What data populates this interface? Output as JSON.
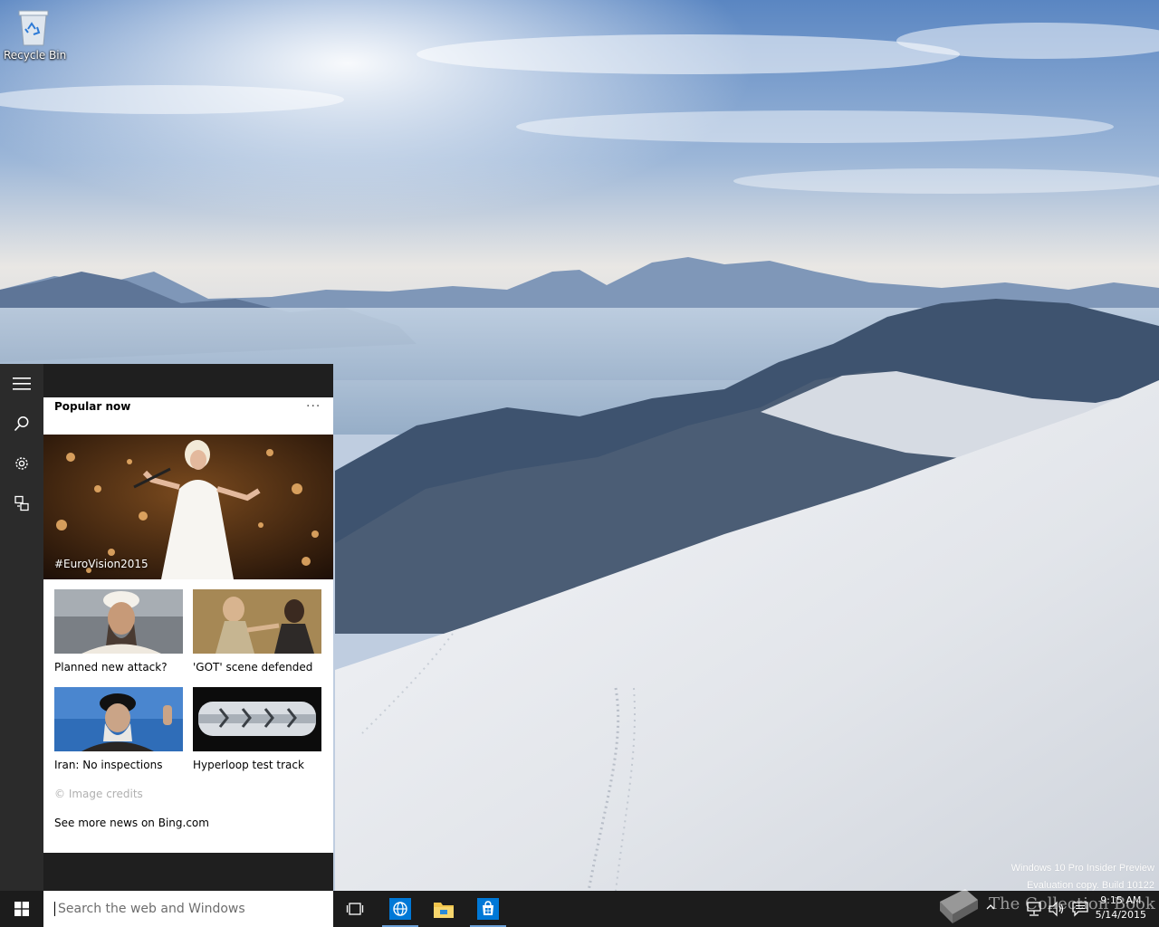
{
  "desktop": {
    "recycle_bin_label": "Recycle Bin",
    "evaluation_line1": "Windows 10 Pro Insider Preview",
    "evaluation_line2": "Evaluation copy. Build 10122"
  },
  "cortana": {
    "rail_icons": [
      "hamburger-menu-icon",
      "search-icon",
      "gear-icon",
      "feedback-icon"
    ],
    "card": {
      "title": "Popular now",
      "more_label": "···",
      "hero_caption": "#EuroVision2015",
      "news": [
        {
          "caption": "Planned new attack?"
        },
        {
          "caption": "'GOT' scene defended"
        },
        {
          "caption": "Iran: No inspections"
        },
        {
          "caption": "Hyperloop test track"
        }
      ],
      "credits": "© Image credits",
      "see_more": "See more news on Bing.com"
    }
  },
  "taskbar": {
    "search_placeholder": "Search the web and Windows",
    "pinned": [
      "task-view-icon",
      "internet-explorer-icon",
      "file-explorer-icon",
      "store-icon"
    ],
    "tray": [
      "show-hidden-icons-icon",
      "network-icon",
      "volume-icon",
      "action-center-icon"
    ],
    "time": "9:15 AM",
    "date": "5/14/2015"
  },
  "watermark": {
    "text": "The Collection Book"
  },
  "colors": {
    "accent": "#0078d7",
    "taskbar": "#1c1c1c",
    "rail": "#2b2b2b"
  }
}
